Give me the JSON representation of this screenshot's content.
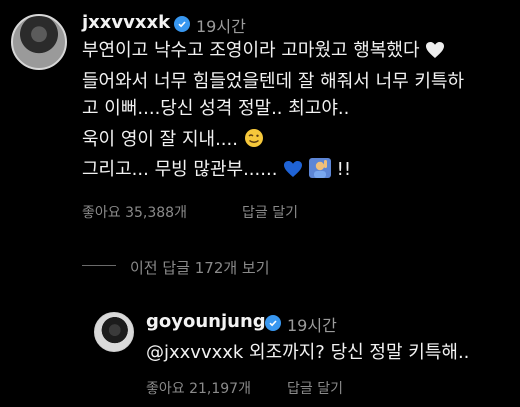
{
  "comment": {
    "username": "jxxvvxxk",
    "time": "19시간",
    "lines": [
      "부연이고 낙수고 조영이라 고마웠고 행복했다",
      "들어와서 너무 힘들었을텐데 잘 해줘서 너무 키특하",
      "고 이뻐....당신 성격 정말.. 최고야..",
      "욱이 영이 잘 지내....",
      "그리고... 무빙 많관부......",
      "!!"
    ],
    "likes": "좋아요 35,388개",
    "reply_label": "답글 달기"
  },
  "view_replies": "이전 답글 172개 보기",
  "reply": {
    "username": "goyounjung",
    "time": "19시간",
    "text": "@jxxvvxxk 외조까지? 당신 정말 키특해..",
    "likes": "좋아요 21,197개",
    "reply_label": "답글 달기"
  },
  "icons": {
    "verified": "verified-badge-icon",
    "white_heart": "white-heart-emoji",
    "wink": "winking-face-emoji",
    "blue_heart": "blue-heart-emoji",
    "raising_hand": "person-raising-hand-emoji"
  },
  "colors": {
    "background": "#000000",
    "verified": "#3897f0",
    "meta": "#8a8a8a"
  }
}
